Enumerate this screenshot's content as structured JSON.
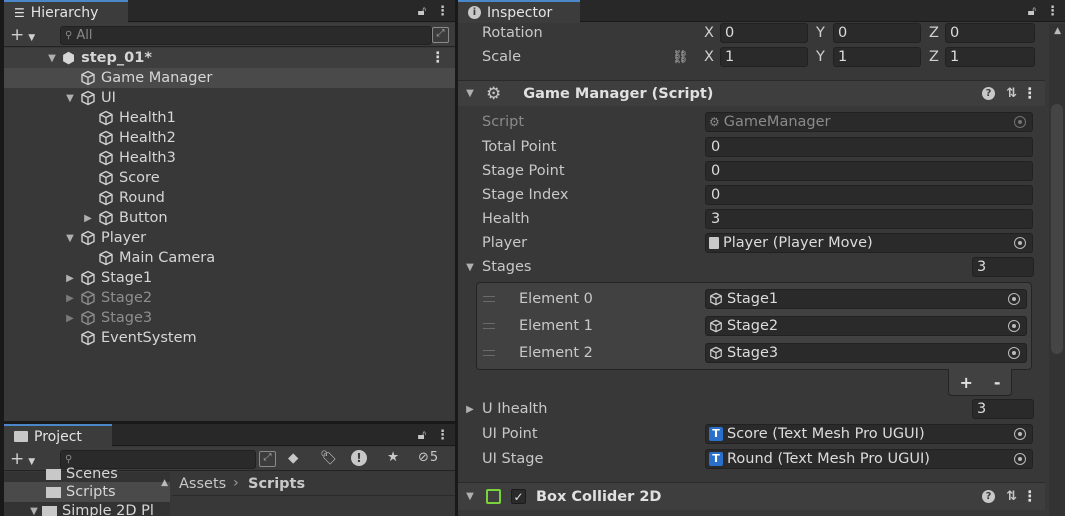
{
  "hierarchy": {
    "tab_label": "Hierarchy",
    "search_placeholder": "All",
    "scene_name": "step_01*",
    "items": [
      {
        "label": "Game Manager"
      },
      {
        "label": "UI"
      },
      {
        "label": "Health1"
      },
      {
        "label": "Health2"
      },
      {
        "label": "Health3"
      },
      {
        "label": "Score"
      },
      {
        "label": "Round"
      },
      {
        "label": "Button"
      },
      {
        "label": "Player"
      },
      {
        "label": "Main Camera"
      },
      {
        "label": "Stage1"
      },
      {
        "label": "Stage2"
      },
      {
        "label": "Stage3"
      },
      {
        "label": "EventSystem"
      }
    ]
  },
  "project": {
    "tab_label": "Project",
    "count_badge": "5",
    "folders": [
      "Scenes",
      "Scripts",
      "Simple 2D Pl"
    ],
    "breadcrumb_root": "Assets",
    "breadcrumb_current": "Scripts"
  },
  "inspector": {
    "tab_label": "Inspector",
    "transform": {
      "rotation_label": "Rotation",
      "scale_label": "Scale",
      "rotation": {
        "x": "0",
        "y": "0",
        "z": "0"
      },
      "scale": {
        "x": "1",
        "y": "1",
        "z": "1"
      },
      "axis_x": "X",
      "axis_y": "Y",
      "axis_z": "Z"
    },
    "script_component": {
      "title": "Game Manager (Script)",
      "fields": {
        "script_label": "Script",
        "script_value": "GameManager",
        "total_point_label": "Total Point",
        "total_point": "0",
        "stage_point_label": "Stage Point",
        "stage_point": "0",
        "stage_index_label": "Stage Index",
        "stage_index": "0",
        "health_label": "Health",
        "health": "3",
        "player_label": "Player",
        "player": "Player (Player Move)",
        "stages_label": "Stages",
        "stages_count": "3",
        "elements": [
          {
            "label": "Element 0",
            "value": "Stage1"
          },
          {
            "label": "Element 1",
            "value": "Stage2"
          },
          {
            "label": "Element 2",
            "value": "Stage3"
          }
        ],
        "add_label": "+",
        "remove_label": "-",
        "uihealth_label": "U Ihealth",
        "uihealth_count": "3",
        "ui_point_label": "UI Point",
        "ui_point": "Score (Text Mesh Pro UGUI)",
        "ui_stage_label": "UI Stage",
        "ui_stage": "Round (Text Mesh Pro UGUI)"
      }
    },
    "collider": {
      "title": "Box Collider 2D"
    }
  },
  "colors": {
    "accent": "#4a86c8",
    "panel": "#383838",
    "field": "#2a2a2a",
    "collider_icon": "#7ad33a"
  }
}
